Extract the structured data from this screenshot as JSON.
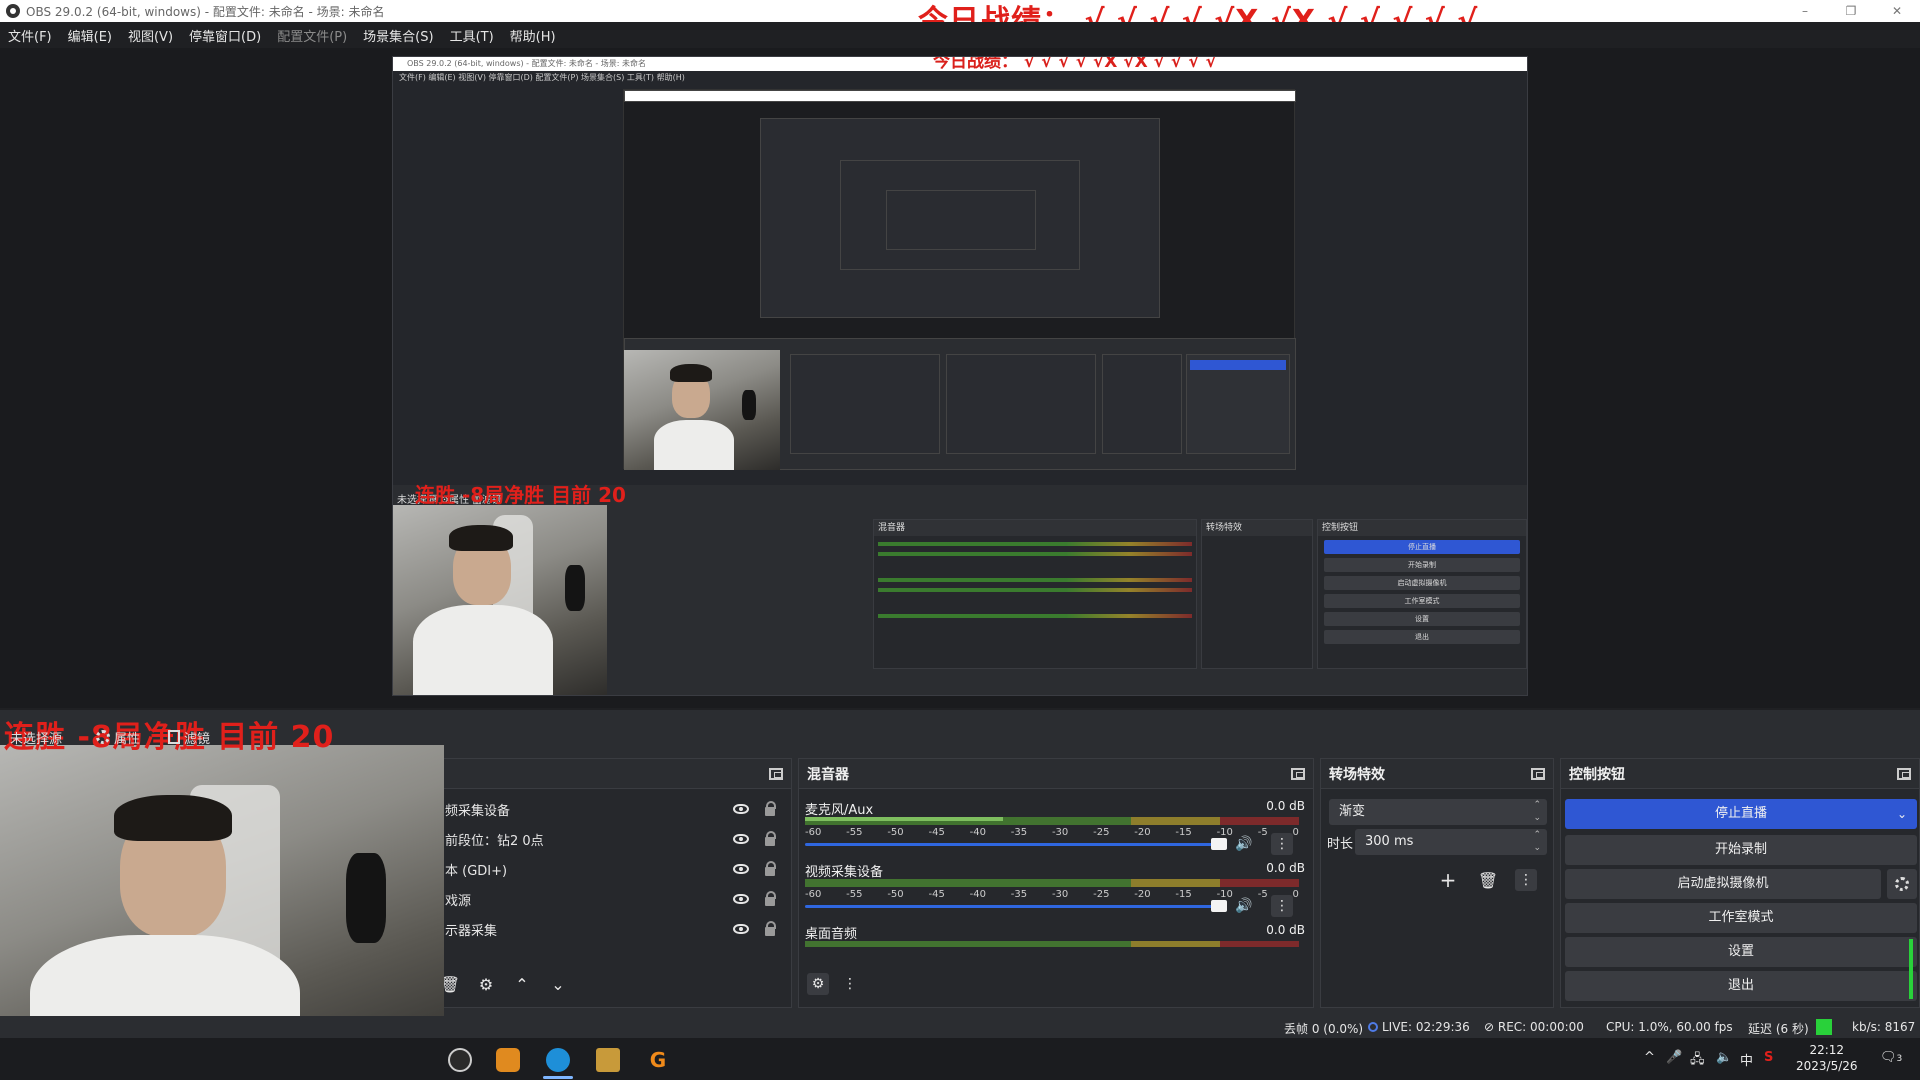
{
  "window": {
    "title": "OBS 29.0.2 (64-bit, windows) - 配置文件: 未命名 - 场景: 未命名",
    "overlay_text": "今日战绩： √ √ √ √ √X √X √ √ √ √ √",
    "controls": {
      "minimize": "–",
      "restore": "❐",
      "close": "✕"
    }
  },
  "menu": [
    {
      "label": "文件(F)",
      "disabled": false
    },
    {
      "label": "编辑(E)",
      "disabled": false
    },
    {
      "label": "视图(V)",
      "disabled": false
    },
    {
      "label": "停靠窗口(D)",
      "disabled": false
    },
    {
      "label": "配置文件(P)",
      "disabled": true
    },
    {
      "label": "场景集合(S)",
      "disabled": false
    },
    {
      "label": "工具(T)",
      "disabled": false
    },
    {
      "label": "帮助(H)",
      "disabled": false
    }
  ],
  "nested_preview": {
    "title": "OBS 29.0.2 (64-bit, windows) - 配置文件: 未命名 - 场景: 未命名",
    "overlay_text": "今日战绩： √ √ √ √ √X √X √ √ √ √",
    "menu": "文件(F)  编辑(E)  视图(V)  停靠窗口(D)  配置文件(P)  场景集合(S)  工具(T)  帮助(H)",
    "scene_bar": "未选择源   ⚙属性   ▥滤镜",
    "overlay_streak": "连胜 -8局净胜  目前 20",
    "panels": {
      "mixer": "混音器",
      "transitions": "转场特效",
      "controls": "控制按钮",
      "stop_stream": "停止直播",
      "start_rec": "开始录制",
      "vcam": "启动虚拟摄像机",
      "studio": "工作室模式",
      "settings": "设置",
      "exit": "退出"
    }
  },
  "overlay_streak": "连胜 -8局净胜  目前 20",
  "scene_bar": {
    "no_source": "未选择源",
    "properties": "属性",
    "filters": "滤镜"
  },
  "sources": {
    "items": [
      {
        "label": "频采集设备"
      },
      {
        "label": "前段位：钻2 0点"
      },
      {
        "label": "本 (GDI+)"
      },
      {
        "label": "戏源"
      },
      {
        "label": "示器采集"
      }
    ],
    "toolbar": {
      "delete": "🗑",
      "settings": "⚙",
      "up": "⌃",
      "down": "⌄"
    }
  },
  "mixer": {
    "title": "混音器",
    "scale": [
      "-60",
      "-55",
      "-50",
      "-45",
      "-40",
      "-35",
      "-30",
      "-25",
      "-20",
      "-15",
      "-10",
      "-5",
      "0"
    ],
    "channels": [
      {
        "name": "麦克风/Aux",
        "db": "0.0 dB"
      },
      {
        "name": "视频采集设备",
        "db": "0.0 dB"
      },
      {
        "name": "桌面音频",
        "db": "0.0 dB"
      }
    ]
  },
  "transitions": {
    "title": "转场特效",
    "selected": "渐变",
    "duration_label": "时长",
    "duration_value": "300 ms"
  },
  "controls": {
    "title": "控制按钮",
    "stop_stream": "停止直播",
    "start_recording": "开始录制",
    "start_vcam": "启动虚拟摄像机",
    "studio_mode": "工作室模式",
    "settings": "设置",
    "exit": "退出"
  },
  "status": {
    "dropped": "丢帧 0 (0.0%)",
    "live": "LIVE: 02:29:36",
    "rec": "REC: 00:00:00",
    "cpu": "CPU: 1.0%, 60.00 fps",
    "delay": "延迟 (6 秒)",
    "bitrate": "kb/s: 8167"
  },
  "taskbar": {
    "tray": {
      "up_arrow": "^",
      "ime": "中"
    },
    "time": "22:12",
    "date": "2023/5/26",
    "notification_count": "3"
  },
  "colors": {
    "overlay_red": "#e0201b",
    "primary_button": "#2f57d3",
    "bitrate_ok": "#29d13a"
  }
}
